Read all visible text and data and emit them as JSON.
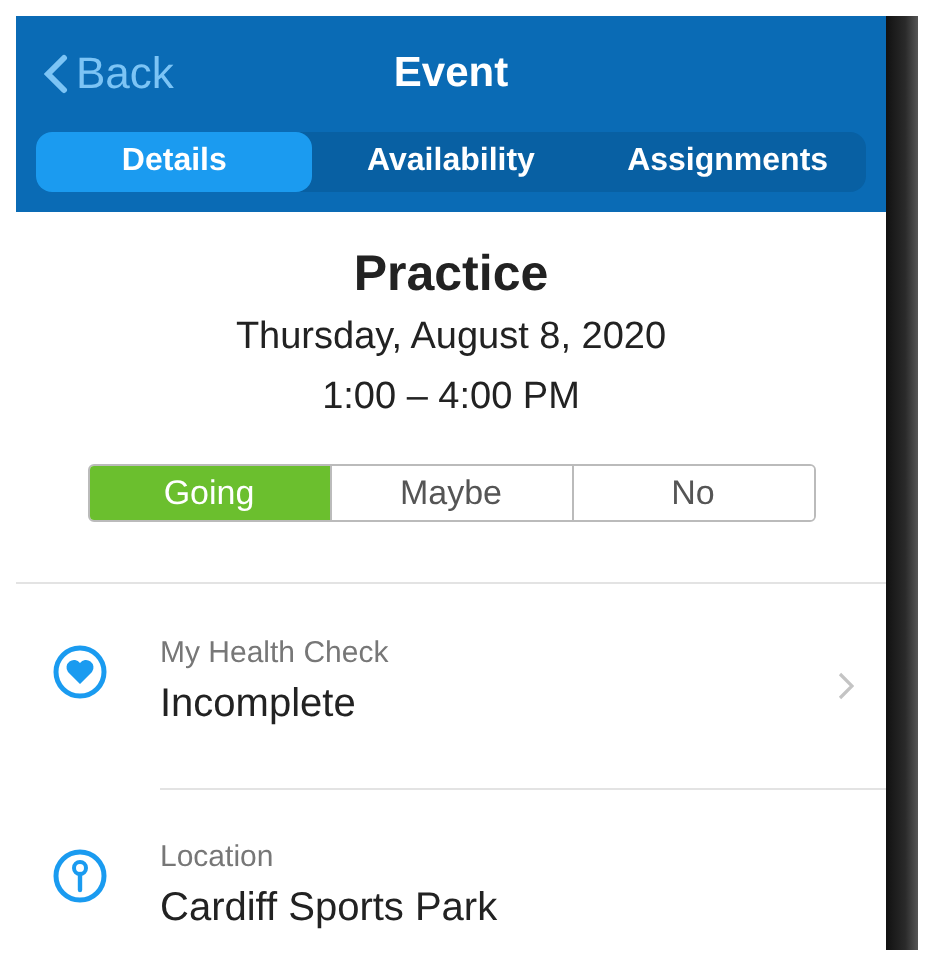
{
  "nav": {
    "back": "Back",
    "title": "Event"
  },
  "tabs": [
    {
      "label": "Details",
      "selected": true
    },
    {
      "label": "Availability",
      "selected": false
    },
    {
      "label": "Assignments",
      "selected": false
    }
  ],
  "event": {
    "title": "Practice",
    "date": "Thursday, August 8, 2020",
    "time": "1:00 – 4:00 PM"
  },
  "rsvp": [
    {
      "label": "Going",
      "selected": true
    },
    {
      "label": "Maybe",
      "selected": false
    },
    {
      "label": "No",
      "selected": false
    }
  ],
  "details": [
    {
      "kind": "health",
      "label": "My Health Check",
      "value": "Incomplete"
    },
    {
      "kind": "location",
      "label": "Location",
      "value": "Cardiff Sports Park"
    }
  ]
}
